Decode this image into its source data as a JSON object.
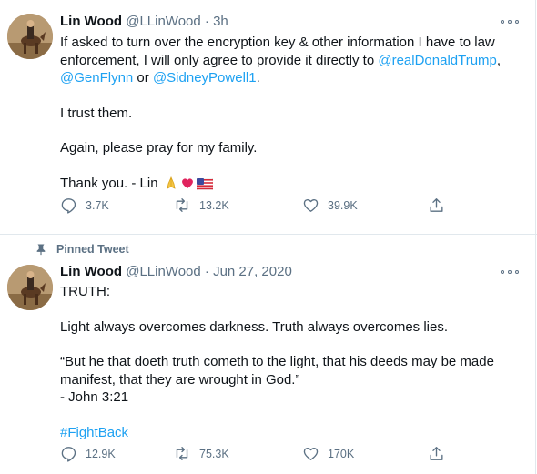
{
  "tweet1": {
    "name": "Lin Wood",
    "handle": "@LLinWood",
    "separator": "·",
    "time": "3h",
    "text_pre": "If asked to turn over the encryption key & other information I have to law enforcement, I will only agree to provide it directly to ",
    "mention1": "@realDonaldTrump",
    "comma": ",",
    "mention2": "@GenFlynn",
    "or": " or ",
    "mention3": "@SidneyPowell1",
    "period": ".",
    "line2": "I trust them.",
    "line3": "Again, please pray for my family.",
    "line4": "Thank you. - Lin",
    "emojis": [
      "folded-hands",
      "red-heart",
      "us-flag"
    ],
    "replies": "3.7K",
    "retweets": "13.2K",
    "likes": "39.9K"
  },
  "tweet2": {
    "pinned_label": "Pinned Tweet",
    "name": "Lin Wood",
    "handle": "@LLinWood",
    "separator": "·",
    "time": "Jun 27, 2020",
    "line1": "TRUTH:",
    "line2": "Light always overcomes darkness. Truth always overcomes lies.",
    "line3": "“But he that doeth truth cometh to the light, that his deeds may be made manifest, that they are wrought in God.”",
    "line4": "- John 3:21",
    "hashtag": "#FightBack",
    "replies": "12.9K",
    "retweets": "75.3K",
    "likes": "170K"
  },
  "colors": {
    "link": "#1da1f2",
    "secondary_text": "#5b7083",
    "primary_text": "#0f1419",
    "divider": "#e1e8ed"
  },
  "icons": [
    "more-icon",
    "reply-icon",
    "retweet-icon",
    "like-icon",
    "share-icon",
    "pin-icon"
  ]
}
